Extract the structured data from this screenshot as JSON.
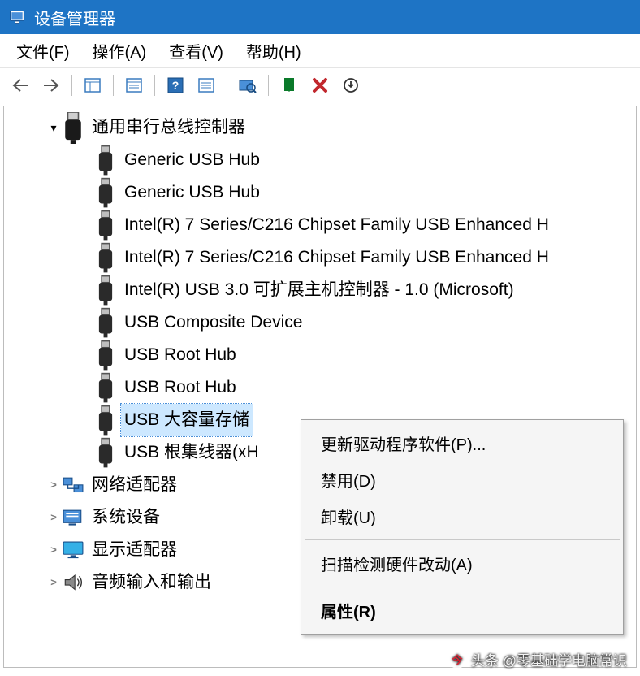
{
  "title": "设备管理器",
  "menubar": {
    "file": "文件(F)",
    "action": "操作(A)",
    "view": "查看(V)",
    "help": "帮助(H)"
  },
  "tree": {
    "usb_root": {
      "label": "通用串行总线控制器",
      "expanded": true
    },
    "usb_children": [
      "Generic USB Hub",
      "Generic USB Hub",
      "Intel(R) 7 Series/C216 Chipset Family USB Enhanced H",
      "Intel(R) 7 Series/C216 Chipset Family USB Enhanced H",
      "Intel(R) USB 3.0 可扩展主机控制器 - 1.0 (Microsoft)",
      "USB Composite Device",
      "USB Root Hub",
      "USB Root Hub",
      "USB 大容量存储",
      "USB 根集线器(xH"
    ],
    "usb_selected_index": 8,
    "net": {
      "label": "网络适配器"
    },
    "sys": {
      "label": "系统设备"
    },
    "disp": {
      "label": "显示适配器"
    },
    "audio": {
      "label": "音频输入和输出"
    }
  },
  "context_menu": {
    "update": "更新驱动程序软件(P)...",
    "disable": "禁用(D)",
    "uninstall": "卸载(U)",
    "scan": "扫描检测硬件改动(A)",
    "properties": "属性(R)"
  },
  "watermark": "头条 @零基础学电脑常识"
}
